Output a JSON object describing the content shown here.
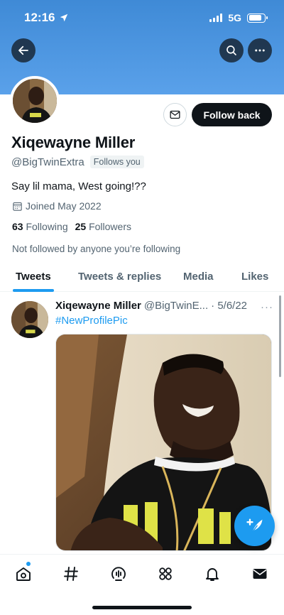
{
  "status_bar": {
    "time": "12:16",
    "network": "5G",
    "battery_level": 0.85
  },
  "profile": {
    "name": "Xiqewayne Miller",
    "handle": "@BigTwinExtra",
    "follows_you_badge": "Follows you",
    "follow_button_label": "Follow back",
    "bio": "Say lil mama, West going!??",
    "joined": "Joined May 2022",
    "following_count": "63",
    "following_label": "Following",
    "followers_count": "25",
    "followers_label": "Followers",
    "not_followed_text": "Not followed by anyone you’re following"
  },
  "tabs": [
    {
      "label": "Tweets",
      "active": true
    },
    {
      "label": "Tweets & replies",
      "active": false
    },
    {
      "label": "Media",
      "active": false
    },
    {
      "label": "Likes",
      "active": false
    }
  ],
  "tweet": {
    "author_name": "Xiqewayne Miller",
    "author_handle": "@BigTwinE...",
    "date": "· 5/6/22",
    "more": "···",
    "hashtag": "#NewProfilePic"
  },
  "icons": {
    "back": "arrow-left-icon",
    "search": "search-icon",
    "more": "more-icon",
    "message": "envelope-icon",
    "compose": "feather-plus-icon",
    "nav": [
      "home-icon",
      "hashtag-icon",
      "spaces-icon",
      "communities-icon",
      "bell-icon",
      "mail-icon"
    ]
  },
  "colors": {
    "banner": "#4a95e0",
    "accent": "#1d9bf0",
    "text": "#0f1419",
    "muted": "#536471"
  }
}
